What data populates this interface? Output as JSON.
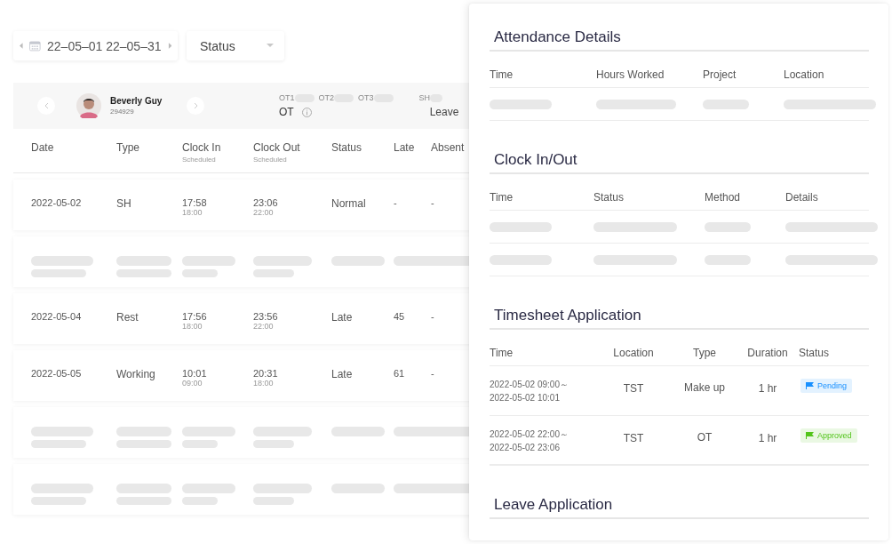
{
  "filters": {
    "date_range": "22–05–01 22–05–31",
    "status_placeholder": "Status"
  },
  "employee": {
    "name": "Beverly Guy",
    "id": "294929"
  },
  "summary": {
    "counters": [
      "OT1",
      "OT2",
      "OT3",
      "SH"
    ],
    "ot_label": "OT",
    "leave_label": "Leave"
  },
  "table": {
    "columns": [
      {
        "label": "Date"
      },
      {
        "label": "Type"
      },
      {
        "label": "Clock In",
        "sub": "Scheduled"
      },
      {
        "label": "Clock Out",
        "sub": "Scheduled"
      },
      {
        "label": "Status"
      },
      {
        "label": "Late"
      },
      {
        "label": "Absent"
      }
    ],
    "rows": [
      {
        "kind": "data",
        "date": "2022-05-02",
        "type": "SH",
        "clock_in": "17:58",
        "clock_in_scheduled": "18:00",
        "clock_out": "23:06",
        "clock_out_scheduled": "22:00",
        "status": "Normal",
        "late": "-",
        "absent": "-"
      },
      {
        "kind": "skeleton"
      },
      {
        "kind": "data",
        "date": "2022-05-04",
        "type": "Rest",
        "clock_in": "17:56",
        "clock_in_scheduled": "18:00",
        "clock_out": "23:56",
        "clock_out_scheduled": "22:00",
        "status": "Late",
        "late": "45",
        "absent": "-"
      },
      {
        "kind": "data",
        "date": "2022-05-05",
        "type": "Working",
        "clock_in": "10:01",
        "clock_in_scheduled": "09:00",
        "clock_out": "20:31",
        "clock_out_scheduled": "18:00",
        "status": "Late",
        "late": "61",
        "absent": "-"
      },
      {
        "kind": "skeleton"
      },
      {
        "kind": "skeleton"
      }
    ]
  },
  "details": {
    "attendance": {
      "title": "Attendance Details",
      "columns": [
        "Time",
        "Hours Worked",
        "Project",
        "Location"
      ]
    },
    "clock": {
      "title": "Clock In/Out",
      "columns": [
        "Time",
        "Status",
        "Method",
        "Details"
      ]
    },
    "timesheet": {
      "title": "Timesheet Application",
      "columns": [
        "Time",
        "Location",
        "Type",
        "Duration",
        "Status"
      ],
      "rows": [
        {
          "start": "2022-05-02 09:00～",
          "end": "2022-05-02 10:01",
          "location": "TST",
          "type": "Make up",
          "duration": "1 hr",
          "status": "Pending",
          "color": "#1890ff"
        },
        {
          "start": "2022-05-02 22:00～",
          "end": "2022-05-02 23:06",
          "location": "TST",
          "type": "OT",
          "duration": "1 hr",
          "status": "Approved",
          "color": "#52c41a"
        }
      ]
    },
    "leave": {
      "title": "Leave Application"
    }
  }
}
